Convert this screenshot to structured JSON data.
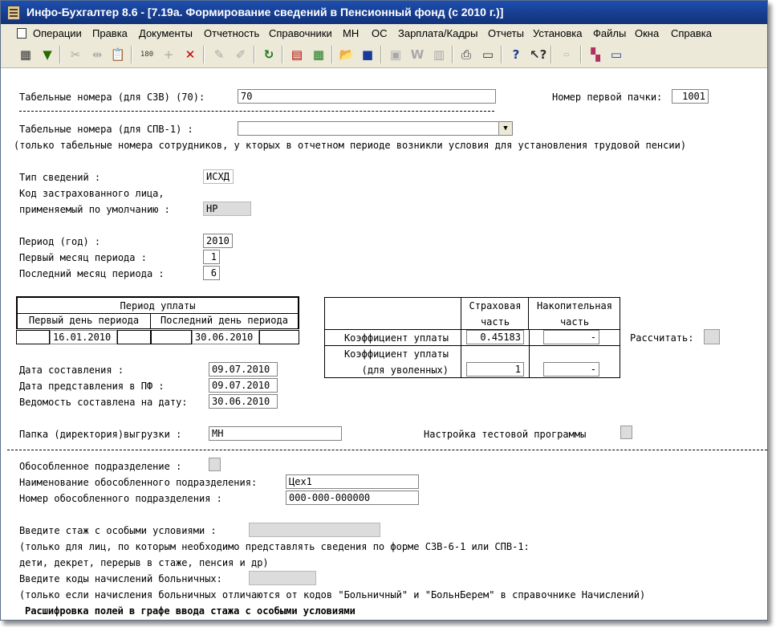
{
  "window": {
    "title": "Инфо-Бухгалтер 8.6 - [7.19а. Формирование сведений в Пенсионный фонд (с 2010 г.)]"
  },
  "menu": [
    "Операции",
    "Правка",
    "Документы",
    "Отчетность",
    "Справочники",
    "МН",
    "ОС",
    "Зарплата/Кадры",
    "Отчеты",
    "Установка",
    "Файлы",
    "Окна",
    "Справка"
  ],
  "toolbar": {
    "icons": [
      "grid-icon",
      "filter-icon",
      "cut-icon",
      "link-icon",
      "paste-icon",
      "number-180-icon",
      "add-icon",
      "delete-icon",
      "mark-icon",
      "mark-all-icon",
      "refresh-icon",
      "calendar-icon",
      "calculator-icon",
      "open-folder-icon",
      "save-icon",
      "report-icon",
      "w-icon",
      "doc-icon",
      "print-icon",
      "preview-icon",
      "help-icon",
      "context-help-icon",
      "spr-icon",
      "exit-icon",
      "window-icon"
    ]
  },
  "form": {
    "tab_svz_label": "Табельные номера (для СЗВ)  (70):",
    "tab_svz_value": "70",
    "first_pack_label": "Номер первой пачки:",
    "first_pack_value": "1001",
    "tab_spv_label": "Табельные номера (для СПВ-1)     :",
    "tab_spv_value": "",
    "tab_spv_note": "(только табельные номера сотрудников, у ктоpых в отчетном пеpиоде возникли условия для установления трудовой пенсии)",
    "info_type_label": "Тип сведений              :",
    "info_type_value": "ИСХД",
    "insured_code_label1": "Код застрахованного лица,",
    "insured_code_label2": "применяемый по умолчанию   :",
    "insured_code_value": "НР",
    "period_year_label": "Период (год)              :",
    "period_year_value": "2010",
    "first_month_label": "Первый месяц периода      :",
    "first_month_value": "1",
    "last_month_label": "Последний месяц периода   :",
    "last_month_value": "6",
    "pay_period_title": "Период уплаты",
    "first_day_label": "Первый день периода",
    "last_day_label": "Последний день периода",
    "first_day_value": "16.01.2010",
    "last_day_value": "30.06.2010",
    "coef_col1": [
      "Страховая",
      "часть"
    ],
    "coef_col2": [
      "Накопительная",
      "часть"
    ],
    "coef_row1_label": "Коэффициент уплаты",
    "coef_row1_val1": "0.45183",
    "coef_row1_val2": "-",
    "coef_row2_label1": "Коэффициент уплаты",
    "coef_row2_label2": "(для уволенных)",
    "coef_row2_val1": "1",
    "coef_row2_val2": "-",
    "calc_label": "Рассчитать:",
    "date_compiled_label": "Дата составления            :",
    "date_compiled_value": "09.07.2010",
    "date_submitted_label": "Дата представления в ПФ     :",
    "date_submitted_value": "09.07.2010",
    "statement_date_label": "Ведомость составлена на дату:",
    "statement_date_value": "30.06.2010",
    "export_folder_label": "Папка (директория)выгрузки  :",
    "export_folder_value": "МН",
    "test_program_label": "Настройка тестовой программы",
    "separate_unit_label": "Обособленное подразделение  :",
    "separate_unit_name_label": "Наименование обособленного подразделения:",
    "separate_unit_name_value": "Цех1",
    "separate_unit_number_label": "Номер обособленного подразделения       :",
    "separate_unit_number_value": "000-000-000000",
    "special_exp_label": "Введите стаж с особыми условиями  :",
    "special_exp_note1": "(только для лиц, по которым необходимо представлять сведения по форме СЗВ-6-1 или СПВ-1:",
    "special_exp_note2": " дети, декрет, перерыв в стаже, пенсия и др)",
    "sick_codes_label": "Введите коды начислений больничных:",
    "sick_codes_note": "(только если начисления больничных отличаются от кодов \"Больничный\" и \"БольнБерем\" в справочнике Начислений)",
    "legend_title": "Расшифровка полей в графе ввода стажа с особыми условиями"
  }
}
